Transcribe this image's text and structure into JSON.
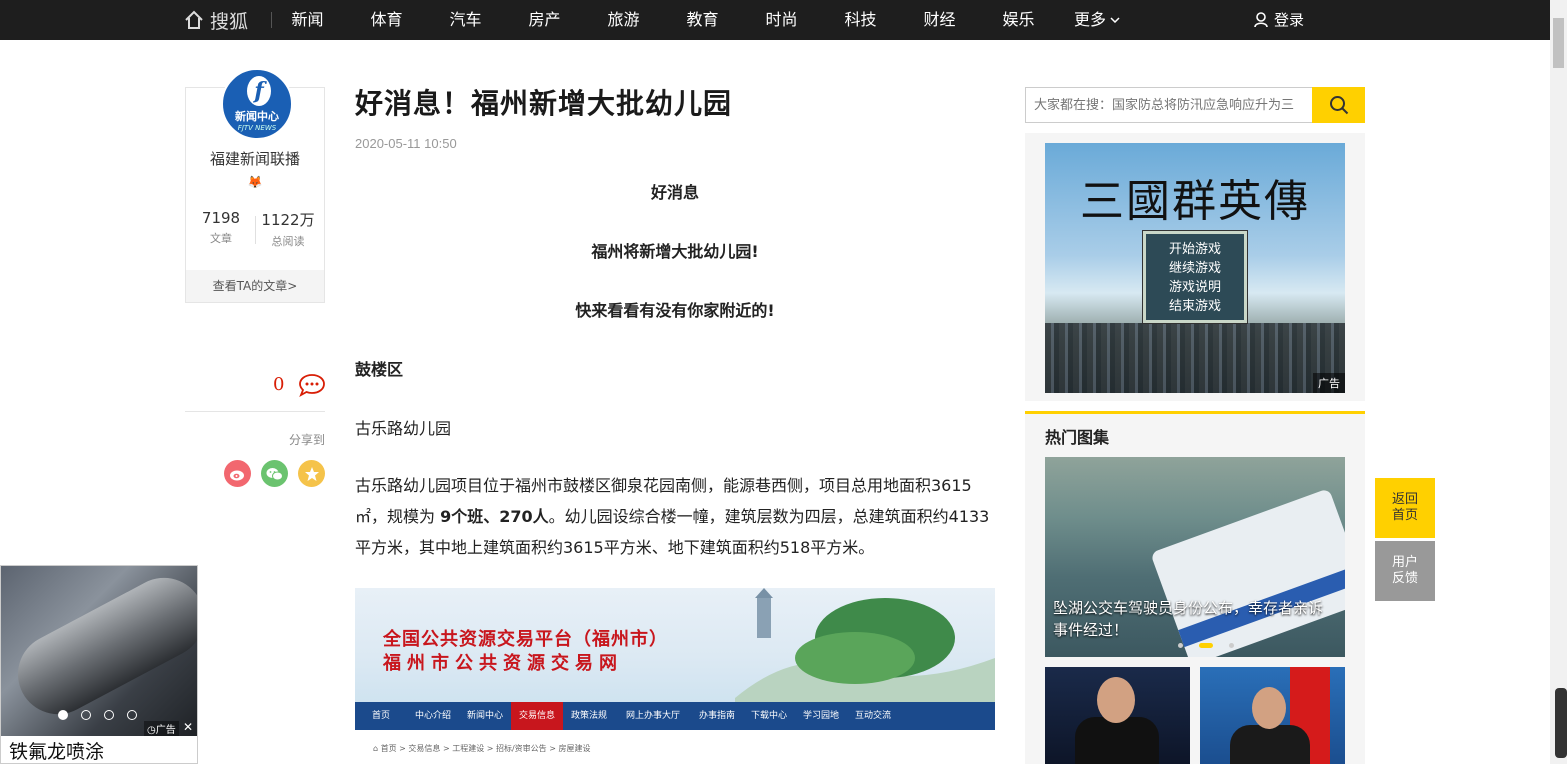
{
  "nav": {
    "logo": "搜狐",
    "items": [
      "新闻",
      "体育",
      "汽车",
      "房产",
      "旅游",
      "教育",
      "时尚",
      "科技",
      "财经",
      "娱乐"
    ],
    "more": "更多",
    "login": "登录"
  },
  "author": {
    "avatar_line1": "新闻中心",
    "avatar_line2": "FJTV NEWS",
    "name": "福建新闻联播",
    "articles_count": "7198",
    "articles_label": "文章",
    "reads_count": "1122万",
    "reads_label": "总阅读",
    "link": "查看TA的文章>"
  },
  "sidebar": {
    "comment_count": "0",
    "share_label": "分享到"
  },
  "article": {
    "title": "好消息！福州新增大批幼儿园",
    "date": "2020-05-11 10:50",
    "line1": "好消息",
    "line2": "福州将新增大批幼儿园!",
    "line3": "快来看看有没有你家附近的!",
    "district": "鼓楼区",
    "school": "古乐路幼儿园",
    "para_a": "古乐路幼儿园项目位于福州市鼓楼区御泉花园南侧，能源巷西侧，项目总用地面积3615㎡，规模为 ",
    "para_b": "9个班、270人",
    "para_c": "。幼儿园设综合楼一幢，建筑层数为四层，总建筑面积约4133平方米，其中地上建筑面积约3615平方米、地下建筑面积约518平方米。"
  },
  "embed": {
    "title1": "全国公共资源交易平台（福州市）",
    "title2": "福州市公共资源交易网",
    "nav": [
      "首页",
      "中心介绍",
      "新闻中心",
      "交易信息",
      "政策法规",
      "网上办事大厅",
      "办事指南",
      "下载中心",
      "学习园地",
      "互动交流"
    ],
    "active_nav": "交易信息",
    "crumb": "首页 > 交易信息 > 工程建设 > 招标/资审公告 > 房屋建设"
  },
  "search": {
    "placeholder": "大家都在搜：国家防总将防汛应急响应升为三"
  },
  "ad": {
    "title": "三國群英傳",
    "menu": [
      "开始游戏",
      "继续游戏",
      "游戏说明",
      "结束游戏"
    ],
    "tag": "广告"
  },
  "hot": {
    "title": "热门图集",
    "caption": "坠湖公交车驾驶员身份公布，幸存者亲诉事件经过！"
  },
  "float": {
    "home": [
      "返回",
      "首页"
    ],
    "feedback": [
      "用户",
      "反馈"
    ]
  },
  "corner_ad": {
    "tag": "广告",
    "close": "✕",
    "text": "铁氟龙喷涂"
  },
  "colors": {
    "nav_bg": "#1e1e1e",
    "accent": "#ffd000",
    "comment_red": "#d81e06"
  }
}
